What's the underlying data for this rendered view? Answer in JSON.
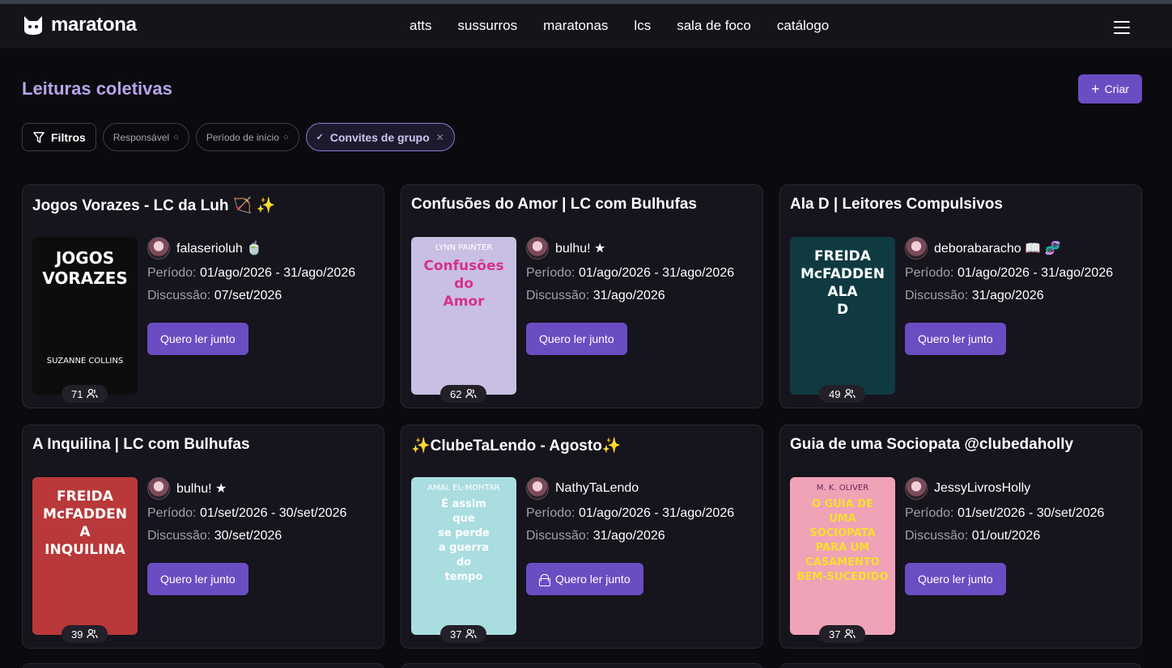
{
  "nav": {
    "brand": "maratona",
    "links": [
      "atts",
      "sussurros",
      "maratonas",
      "lcs",
      "sala de foco",
      "catálogo"
    ],
    "menu_icon": "hamburger-icon"
  },
  "page": {
    "title": "Leituras coletivas",
    "create_label": "Criar"
  },
  "filters": {
    "filters_label": "Filtros",
    "responsavel": "Responsável",
    "periodo": "Período de início",
    "convites": "Convites de grupo"
  },
  "labels": {
    "periodo": "Período:",
    "discussao": "Discussão:",
    "join": "Quero ler junto"
  },
  "cards": [
    {
      "title": "Jogos Vorazes - LC da Luh 🏹 ✨",
      "user": "falaserioluh 🍵",
      "periodo": "01/ago/2026 - 31/ago/2026",
      "discussao": "07/set/2026",
      "count": "71",
      "locked": false
    },
    {
      "title": "Confusões do Amor | LC com Bulhufas",
      "user": "bulhu! ★",
      "periodo": "01/ago/2026 - 31/ago/2026",
      "discussao": "31/ago/2026",
      "count": "62",
      "locked": false
    },
    {
      "title": "Ala D | Leitores Compulsivos",
      "user": "deborabaracho 📖 🧬",
      "periodo": "01/ago/2026 - 31/ago/2026",
      "discussao": "31/ago/2026",
      "count": "49",
      "locked": false
    },
    {
      "title": "A Inquilina | LC com Bulhufas",
      "user": "bulhu! ★",
      "periodo": "01/set/2026 - 30/set/2026",
      "discussao": "30/set/2026",
      "count": "39",
      "locked": false
    },
    {
      "title": "✨ClubeTaLendo - Agosto✨",
      "user": "NathyTaLendo",
      "periodo": "01/ago/2026 - 31/ago/2026",
      "discussao": "31/ago/2026",
      "count": "37",
      "locked": true
    },
    {
      "title": "Guia de uma Sociopata @clubedaholly",
      "user": "JessyLivrosHolly",
      "periodo": "01/set/2026 - 30/set/2026",
      "discussao": "01/out/2026",
      "count": "37",
      "locked": false
    }
  ],
  "covers": [
    {
      "lines": [
        "JOGOS",
        "VORAZES"
      ],
      "author": "SUZANNE COLLINS",
      "bg": "#0d0d0d",
      "fg": "#ffffff"
    },
    {
      "lines": [
        "Confusões",
        "do",
        "Amor"
      ],
      "author": "LYNN PAINTER",
      "bg": "#c9bfe3",
      "fg": "#d6328c"
    },
    {
      "lines": [
        "FREIDA",
        "McFADDEN",
        "ALA",
        "D"
      ],
      "author": "",
      "bg": "#0f3a42",
      "fg": "#ffffff"
    },
    {
      "lines": [
        "FREIDA",
        "McFADDEN",
        "A",
        "INQUILINA"
      ],
      "author": "",
      "bg": "#b9383a",
      "fg": "#ffffff"
    },
    {
      "lines": [
        "É assim",
        "que",
        "se perde",
        "a guerra",
        "do",
        "tempo"
      ],
      "author": "AMAL EL-MOHTAR",
      "bg": "#a9dde0",
      "fg": "#ffffff"
    },
    {
      "lines": [
        "O GUIA DE",
        "UMA",
        "SOCIOPATA",
        "PARA UM",
        "CASAMENTO",
        "BEM-SUCEDIDO"
      ],
      "author": "M. K. OLIVER",
      "bg": "#f0a2b7",
      "fg": "#f6e02b"
    }
  ]
}
